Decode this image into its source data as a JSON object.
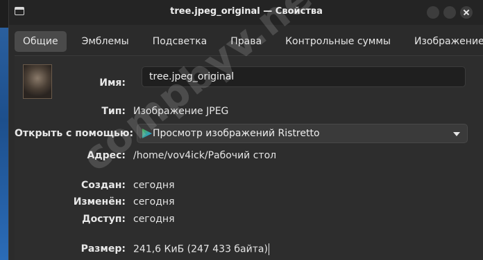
{
  "window": {
    "title": "tree.jpeg_original — Свойства"
  },
  "tabs": [
    {
      "label": "Общие",
      "active": true
    },
    {
      "label": "Эмблемы"
    },
    {
      "label": "Подсветка"
    },
    {
      "label": "Права"
    },
    {
      "label": "Контрольные суммы"
    },
    {
      "label": "Изображение"
    }
  ],
  "general": {
    "name_label": "Имя:",
    "name_value": "tree.jpeg_original",
    "type_label": "Тип:",
    "type_value": "Изображение JPEG",
    "open_with_label": "Открыть с помощью:",
    "open_with_value": "Просмотр изображений Ristretto",
    "address_label": "Адрес:",
    "address_value": "/home/vov4ick/Рабочий стол",
    "created_label": "Создан:",
    "created_value": "сегодня",
    "modified_label": "Изменён:",
    "modified_value": "сегодня",
    "accessed_label": "Доступ:",
    "accessed_value": "сегодня",
    "size_label": "Размер:",
    "size_value": "241,6 КиБ (247 433 байта)"
  },
  "watermark": "compbyv.net",
  "icons": {
    "app": "window-icon",
    "open_with_app": "ristretto-icon",
    "dropdown": "chevron-down-icon"
  }
}
